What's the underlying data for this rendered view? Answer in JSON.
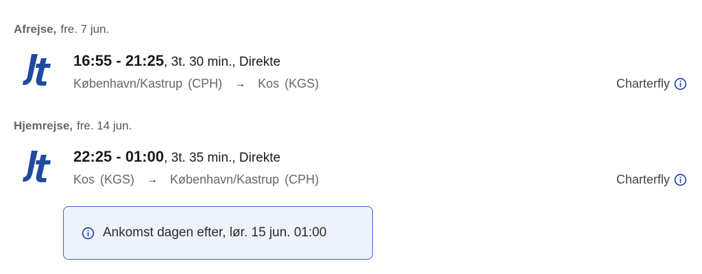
{
  "outbound": {
    "direction": "Afrejse,",
    "date": "fre. 7 jun.",
    "airline_icon": "jettime-logo",
    "times": "16:55 - 21:25",
    "details": ", 3t. 30 min., Direkte",
    "from_city": "København/Kastrup",
    "from_code": "(CPH)",
    "to_city": "Kos",
    "to_code": "(KGS)",
    "flight_type": "Charterfly"
  },
  "return": {
    "direction": "Hjemrejse,",
    "date": "fre. 14 jun.",
    "airline_icon": "jettime-logo",
    "times": "22:25 - 01:00",
    "details": ", 3t. 35 min., Direkte",
    "from_city": "Kos",
    "from_code": "(KGS)",
    "to_city": "København/Kastrup",
    "to_code": "(CPH)",
    "flight_type": "Charterfly"
  },
  "notice": {
    "text": "Ankomst dagen efter, lør. 15 jun. 01:00",
    "icon": "info-icon"
  },
  "colors": {
    "logo_blue": "#1f4a9e",
    "info_blue": "#2a3fa8",
    "notice_bg": "#eef3fb",
    "notice_border": "#3a64c8"
  }
}
